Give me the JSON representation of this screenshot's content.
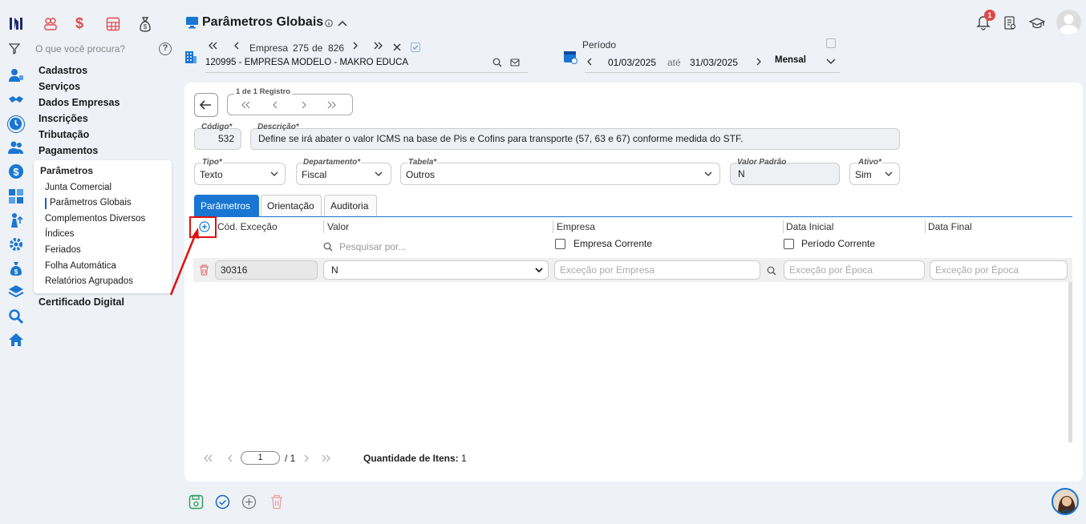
{
  "app": {
    "title": "Parâmetros Globais"
  },
  "rail_icons": [
    "logo-icon",
    "people-icon",
    "dollar-icon",
    "calculator-icon",
    "money-bag-icon"
  ],
  "side_icons": [
    "filter-icon",
    "contacts-icon",
    "handshake-icon",
    "clock-icon",
    "users-icon",
    "dollar-circle-icon",
    "grid-icon",
    "person-up-icon",
    "gear-icon",
    "money-bag-icon",
    "layers-icon",
    "search-icon",
    "home-icon"
  ],
  "menu": {
    "search_placeholder": "O que você procura?",
    "help": "?",
    "items": [
      "Cadastros",
      "Serviços",
      "Dados Empresas",
      "Inscrições",
      "Tributação",
      "Pagamentos"
    ],
    "submenu_title": "Parâmetros",
    "submenu_items": [
      "Junta Comercial",
      "Parâmetros Globais",
      "Complementos Diversos",
      "Índices",
      "Feriados",
      "Folha Automática",
      "Relatórios Agrupados"
    ],
    "selected": "Parâmetros Globais",
    "after_item": "Certificado Digital"
  },
  "company_nav": {
    "label": "Empresa",
    "current": "275",
    "of": "de",
    "total": "826",
    "name": "120995 - EMPRESA MODELO - MAKRO EDUCA"
  },
  "period": {
    "label": "Período",
    "start": "01/03/2025",
    "until": "até",
    "end": "31/03/2025",
    "mode": "Mensal"
  },
  "header_right": {
    "notification_count": "1"
  },
  "record": {
    "label": "1 de 1 Registro"
  },
  "form": {
    "codigo_label": "Código*",
    "codigo": "532",
    "descricao_label": "Descrição*",
    "descricao": "Define se irá abater o valor ICMS na base de Pis e Cofins para transporte (57, 63 e 67) conforme medida do STF.",
    "tipo_label": "Tipo*",
    "tipo": "Texto",
    "departamento_label": "Departamento*",
    "departamento": "Fiscal",
    "tabela_label": "Tabela*",
    "tabela": "Outros",
    "valor_padrao_label": "Valor Padrão",
    "valor_padrao": "N",
    "ativo_label": "Ativo*",
    "ativo": "Sim"
  },
  "tabs": [
    "Parâmetros",
    "Orientação",
    "Auditoria"
  ],
  "grid": {
    "headers": {
      "cod": "Cód. Exceção",
      "valor": "Valor",
      "empresa": "Empresa",
      "data_inicial": "Data Inicial",
      "data_final": "Data Final"
    },
    "search_placeholder": "Pesquisar por...",
    "empresa_corrente": "Empresa Corrente",
    "periodo_corrente": "Período Corrente",
    "row": {
      "cod": "30316",
      "valor": "N",
      "empresa_placeholder": "Exceção por Empresa",
      "data_inicial_placeholder": "Exceção por Época",
      "data_final_placeholder": "Exceção por Época"
    }
  },
  "pager": {
    "page": "1",
    "total": "/ 1",
    "qty_label": "Quantidade de Itens:",
    "qty": "1"
  },
  "colors": {
    "accent": "#1976d2",
    "highlight": "#e01010",
    "danger": "#e57373",
    "success": "#2e9e5b"
  }
}
